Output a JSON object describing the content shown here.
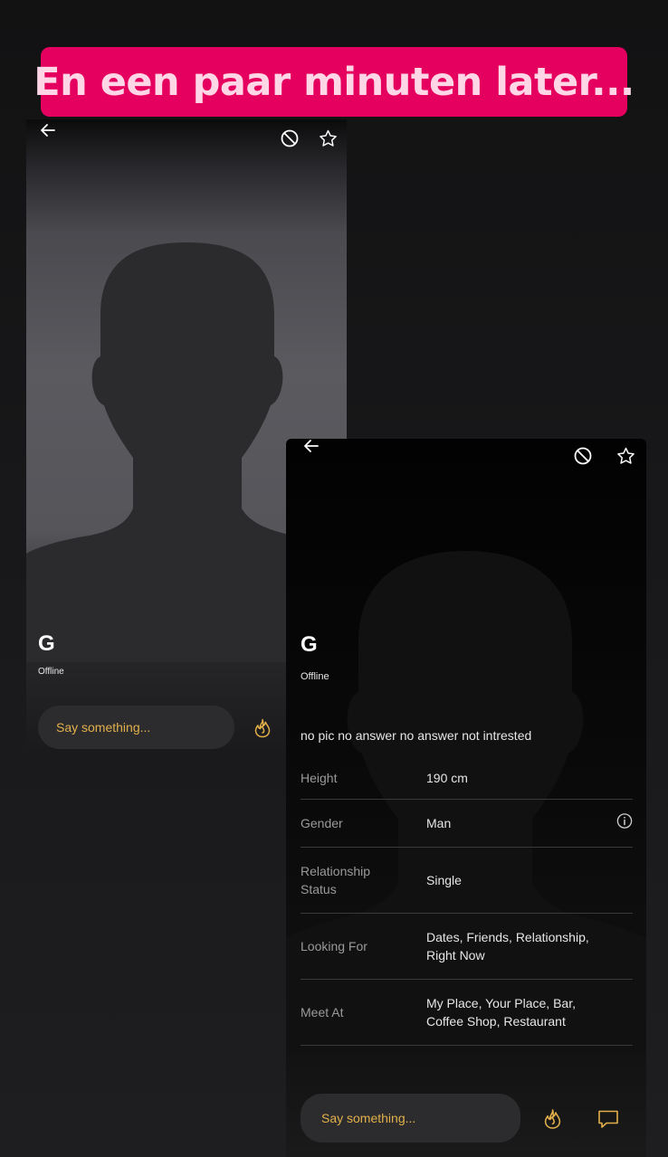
{
  "caption": "En een paar minuten later...",
  "colors": {
    "accent": "#e5005f",
    "gold": "#e2b04a"
  },
  "card1": {
    "name": "G",
    "status": "Offline",
    "input_placeholder": "Say something..."
  },
  "card2": {
    "name": "G",
    "status": "Offline",
    "bio": "no pic no answer no answer not intrested",
    "details": [
      {
        "label": "Height",
        "value": "190 cm"
      },
      {
        "label": "Gender",
        "value": "Man"
      },
      {
        "label": "Relationship Status",
        "value": "Single"
      },
      {
        "label": "Looking For",
        "value": "Dates, Friends, Relationship, Right Now"
      },
      {
        "label": "Meet At",
        "value": "My Place, Your Place, Bar, Coffee Shop, Restaurant"
      }
    ],
    "input_placeholder": "Say something..."
  },
  "icons": {
    "back": "arrow-left-icon",
    "block": "block-icon",
    "favorite": "star-icon",
    "tap": "flame-icon",
    "chat": "chat-bubble-icon",
    "info": "info-icon"
  }
}
